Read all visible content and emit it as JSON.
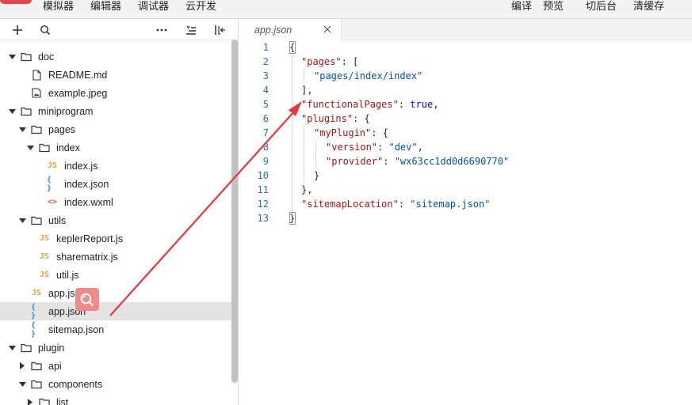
{
  "menu": {
    "left": [
      "模拟器",
      "编辑器",
      "调试器",
      "云开发"
    ],
    "right": [
      "编译",
      "预览",
      "切后台",
      "清缓存"
    ]
  },
  "explorer": {
    "toolbar": [
      "add-icon",
      "search-icon",
      "more-icon",
      "sort-icon",
      "collapse-panel-icon"
    ],
    "tree": [
      {
        "label": "doc",
        "type": "folder",
        "expanded": true,
        "depth": 0
      },
      {
        "label": "README.md",
        "type": "md",
        "depth": 1
      },
      {
        "label": "example.jpeg",
        "type": "image",
        "depth": 1
      },
      {
        "label": "miniprogram",
        "type": "folder",
        "expanded": true,
        "depth": 0
      },
      {
        "label": "pages",
        "type": "folder",
        "expanded": true,
        "depth": 1
      },
      {
        "label": "index",
        "type": "folder",
        "expanded": true,
        "depth": 2
      },
      {
        "label": "index.js",
        "type": "js",
        "depth": 3
      },
      {
        "label": "index.json",
        "type": "json",
        "depth": 3
      },
      {
        "label": "index.wxml",
        "type": "wxml",
        "depth": 3
      },
      {
        "label": "utils",
        "type": "folder",
        "expanded": true,
        "depth": 1
      },
      {
        "label": "keplerReport.js",
        "type": "js",
        "depth": 2
      },
      {
        "label": "sharematrix.js",
        "type": "js",
        "depth": 2
      },
      {
        "label": "util.js",
        "type": "js",
        "depth": 2
      },
      {
        "label": "app.js",
        "type": "js",
        "depth": 1
      },
      {
        "label": "app.json",
        "type": "json",
        "depth": 1,
        "selected": true
      },
      {
        "label": "sitemap.json",
        "type": "json",
        "depth": 1
      },
      {
        "label": "plugin",
        "type": "folder",
        "expanded": true,
        "depth": 0
      },
      {
        "label": "api",
        "type": "folder",
        "expanded": false,
        "depth": 1
      },
      {
        "label": "components",
        "type": "folder",
        "expanded": true,
        "depth": 1
      },
      {
        "label": "list",
        "type": "folder",
        "expanded": false,
        "depth": 2
      }
    ]
  },
  "editor": {
    "tab": {
      "label": "app.json"
    },
    "lines": [
      "1",
      "2",
      "3",
      "4",
      "5",
      "6",
      "7",
      "8",
      "9",
      "10",
      "11",
      "12",
      "13"
    ],
    "code": {
      "l2_key": "\"pages\"",
      "l2_rest": ": [",
      "l3_val": "\"pages/index/index\"",
      "l4": "],",
      "l5_key": "\"functionalPages\"",
      "l5_colon": ": ",
      "l5_val": "true",
      "l5_end": ",",
      "l6_key": "\"plugins\"",
      "l6_rest": ": {",
      "l7_key": "\"myPlugin\"",
      "l7_rest": ": {",
      "l8_key": "\"version\"",
      "l8_colon": ": ",
      "l8_val": "\"dev\"",
      "l8_end": ",",
      "l9_key": "\"provider\"",
      "l9_colon": ": ",
      "l9_val": "\"wx63cc1dd0d6690770\"",
      "l10": "}",
      "l11": "},",
      "l12_key": "\"sitemapLocation\"",
      "l12_colon": ": ",
      "l12_val": "\"sitemap.json\"",
      "l1": "{",
      "l13": "}"
    }
  },
  "colors": {
    "annotation_arrow": "#e8363a",
    "selected_row": "#e4e4e4"
  }
}
